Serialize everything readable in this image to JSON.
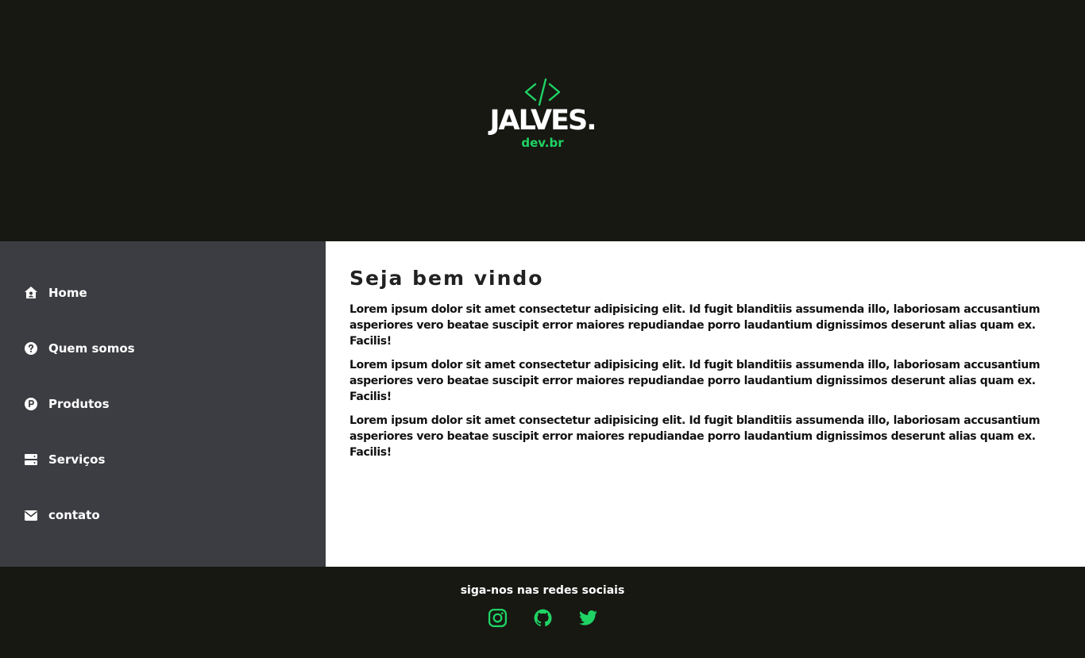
{
  "brand": {
    "mark": "</>",
    "name": "JALVES.",
    "subtitle": "dev.br",
    "accent": "#1fd364"
  },
  "nav": {
    "items": [
      {
        "label": "Home",
        "icon": "house-user-icon"
      },
      {
        "label": "Quem somos",
        "icon": "question-circle-icon"
      },
      {
        "label": "Produtos",
        "icon": "product-p-icon"
      },
      {
        "label": "Serviços",
        "icon": "server-icon"
      },
      {
        "label": "contato",
        "icon": "envelope-icon"
      }
    ]
  },
  "main": {
    "title": "Seja bem vindo",
    "paragraphs": [
      "Lorem ipsum dolor sit amet consectetur adipisicing elit. Id fugit blanditiis assumenda illo, laboriosam accusantium asperiores vero beatae suscipit error maiores repudiandae porro laudantium dignissimos deserunt alias quam ex. Facilis!",
      "Lorem ipsum dolor sit amet consectetur adipisicing elit. Id fugit blanditiis assumenda illo, laboriosam accusantium asperiores vero beatae suscipit error maiores repudiandae porro laudantium dignissimos deserunt alias quam ex. Facilis!",
      "Lorem ipsum dolor sit amet consectetur adipisicing elit. Id fugit blanditiis assumenda illo, laboriosam accusantium asperiores vero beatae suscipit error maiores repudiandae porro laudantium dignissimos deserunt alias quam ex. Facilis!"
    ]
  },
  "footer": {
    "text": "siga-nos nas redes sociais",
    "social": [
      "instagram-icon",
      "github-icon",
      "twitter-icon"
    ]
  }
}
